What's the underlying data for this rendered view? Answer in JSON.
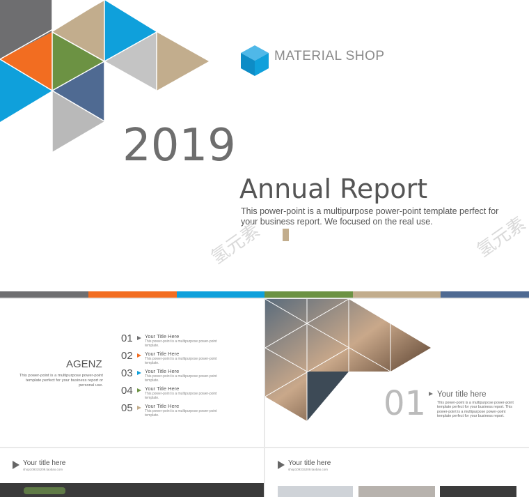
{
  "colors": {
    "gray": "#6e6e70",
    "orange": "#f26d21",
    "blue": "#0fa0db",
    "green": "#6c9243",
    "tan": "#c2ad8d",
    "navy": "#4f6a92",
    "lightgray": "#b9b9b9",
    "midgray": "#c4c4c4"
  },
  "hero": {
    "brand": "MATERIAL SHOP",
    "brand_icon": "cube-icon",
    "year": "2019",
    "title": "Annual Report",
    "desc_line1": "This power-point is a multipurpose power-point template perfect for",
    "desc_line2": "your business report. We focused on the real use.",
    "watermark": "氢元素"
  },
  "agenda": {
    "title": "AGENZ",
    "desc": "This power-point is a multipurpose power-point template perfect for your business report or personal use.",
    "items": [
      {
        "num": "01",
        "title": "Your Title Here",
        "text": "This power-point is a multipurpose power-point template.",
        "color": "#6e6e70"
      },
      {
        "num": "02",
        "title": "Your Title Here",
        "text": "This power-point is a multipurpose power-point template.",
        "color": "#f26d21"
      },
      {
        "num": "03",
        "title": "Your Title Here",
        "text": "This power-point is a multipurpose power-point template.",
        "color": "#0fa0db"
      },
      {
        "num": "04",
        "title": "Your Title Here",
        "text": "This power-point is a multipurpose power-point template.",
        "color": "#6c9243"
      },
      {
        "num": "05",
        "title": "Your Title Here",
        "text": "This power-point is a multipurpose power-point template.",
        "color": "#c2ad8d"
      }
    ]
  },
  "section": {
    "num": "01",
    "title": "Your title here",
    "desc": "This power-point is a multipurpose power-point template perfect for your business report. This power-point is a multipurpose power-point template perfect for your business report."
  },
  "thumb3": {
    "title": "Your title here",
    "sub": "shop109315209.taobao.com"
  },
  "thumb4": {
    "title": "Your title here",
    "sub": "shop109315209.taobao.com"
  }
}
